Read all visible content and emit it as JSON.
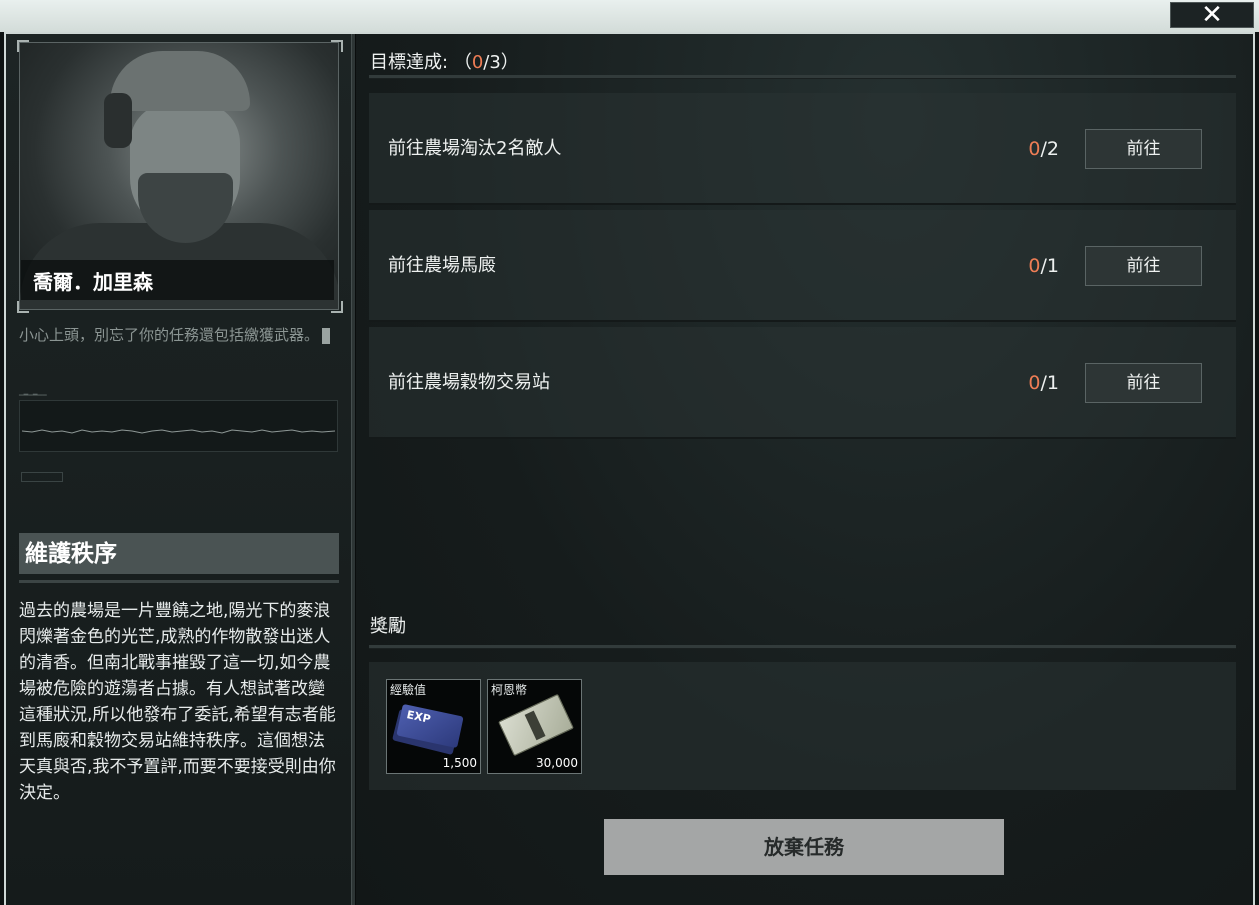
{
  "window": {
    "close_label": "✕"
  },
  "character": {
    "name": "喬爾．加里森",
    "quote": "小心上頭，別忘了你的任務還包括繳獲武器。"
  },
  "mission": {
    "title": "維護秩序",
    "description": "過去的農場是一片豐饒之地,陽光下的麥浪閃爍著金色的光芒,成熟的作物散發出迷人的清香。但南北戰事摧毀了這一切,如今農場被危險的遊蕩者占據。有人想試著改變這種狀況,所以他發布了委託,希望有志者能到馬廄和穀物交易站維持秩序。這個想法天真與否,我不予置評,而要不要接受則由你決定。"
  },
  "objectives_header": {
    "label": "目標達成:",
    "open": "（",
    "done": "0",
    "total": "/3",
    "close": "）"
  },
  "objectives": [
    {
      "text": "前往農場淘汰2名敵人",
      "done": "0",
      "total": "/2",
      "button": "前往"
    },
    {
      "text": "前往農場馬廄",
      "done": "0",
      "total": "/1",
      "button": "前往"
    },
    {
      "text": "前往農場穀物交易站",
      "done": "0",
      "total": "/1",
      "button": "前往"
    }
  ],
  "rewards_label": "獎勵",
  "rewards": [
    {
      "name": "經驗值",
      "qty": "1,500",
      "icon": "exp-ticket-icon"
    },
    {
      "name": "柯恩幣",
      "qty": "30,000",
      "icon": "cash-stack-icon"
    }
  ],
  "abandon_label": "放棄任務",
  "colors": {
    "accent": "#ee7d55",
    "title_bar": "#4a5353",
    "abandon_btn": "#a4a6a6"
  }
}
